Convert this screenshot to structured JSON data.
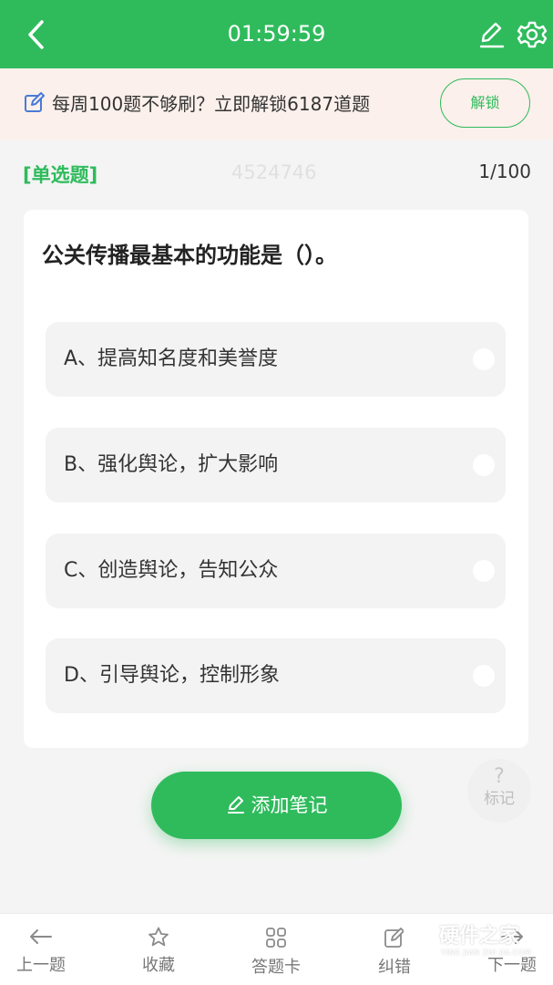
{
  "header": {
    "timer": "01:59:59",
    "back_icon": "chevron-left-icon",
    "edit_icon": "pencil-icon",
    "settings_icon": "gear-icon",
    "color": "#2fbb5c"
  },
  "promo": {
    "icon": "edit-square-icon",
    "text": "每周100题不够刷？立即解锁6187道题",
    "button_label": "解锁"
  },
  "question_meta": {
    "type_label": "[单选题]",
    "id": "4524746",
    "progress": "1/100"
  },
  "question": {
    "text": "公关传播最基本的功能是（）。",
    "options": [
      {
        "label": "A、提高知名度和美誉度"
      },
      {
        "label": "B、强化舆论，扩大影响"
      },
      {
        "label": "C、创造舆论，告知公众"
      },
      {
        "label": "D、引导舆论，控制形象"
      }
    ]
  },
  "actions": {
    "add_note_label": "添加笔记",
    "mark_symbol": "?",
    "mark_label": "标记"
  },
  "bottom_nav": [
    {
      "label": "上一题",
      "icon": "arrow-left-icon"
    },
    {
      "label": "收藏",
      "icon": "star-icon"
    },
    {
      "label": "答题卡",
      "icon": "grid-icon"
    },
    {
      "label": "纠错",
      "icon": "edit-icon"
    },
    {
      "label": "下一题",
      "icon": "arrow-right-icon"
    }
  ],
  "watermark": {
    "name": "硬件之家",
    "sub": "YING JIAN ZHI JIA.COM"
  }
}
